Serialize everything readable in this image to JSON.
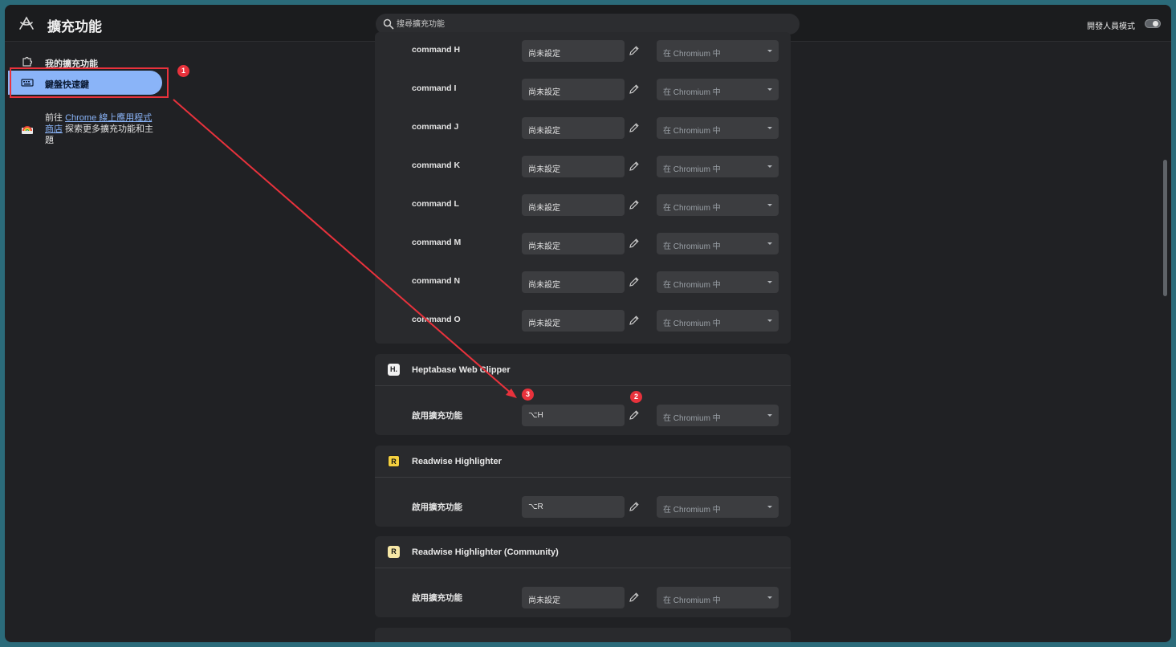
{
  "app": {
    "title": "擴充功能"
  },
  "search": {
    "placeholder": "搜尋擴充功能"
  },
  "dev_mode": {
    "label": "開發人員模式",
    "enabled": false
  },
  "sidebar": {
    "items": [
      {
        "label": "我的擴充功能",
        "icon": "puzzle-icon",
        "selected": false
      },
      {
        "label": "鍵盤快速鍵",
        "icon": "keyboard-icon",
        "selected": true
      }
    ],
    "store": {
      "prefix": "前往 ",
      "link_text": "Chrome 線上應用程式商店",
      "suffix": " 探索更多擴充功能和主題"
    }
  },
  "scope_text": "在 Chromium 中",
  "top_card": {
    "rows": [
      {
        "command": "command H",
        "shortcut": "尚未設定"
      },
      {
        "command": "command I",
        "shortcut": "尚未設定"
      },
      {
        "command": "command J",
        "shortcut": "尚未設定"
      },
      {
        "command": "command K",
        "shortcut": "尚未設定"
      },
      {
        "command": "command L",
        "shortcut": "尚未設定"
      },
      {
        "command": "command M",
        "shortcut": "尚未設定"
      },
      {
        "command": "command N",
        "shortcut": "尚未設定"
      },
      {
        "command": "command O",
        "shortcut": "尚未設定"
      }
    ]
  },
  "extensions": [
    {
      "name": "Heptabase Web Clipper",
      "icon": "heptabase-icon",
      "icon_text": "H.",
      "command": "啟用擴充功能",
      "shortcut": "⌥H"
    },
    {
      "name": "Readwise Highlighter",
      "icon": "readwise-icon",
      "icon_text": "R",
      "command": "啟用擴充功能",
      "shortcut": "⌥R"
    },
    {
      "name": "Readwise Highlighter (Community)",
      "icon": "readwise-community-icon",
      "icon_text": "R",
      "command": "啟用擴充功能",
      "shortcut": "尚未設定"
    }
  ],
  "annotations": {
    "badge1": "1",
    "badge2": "2",
    "badge3": "3"
  },
  "colors": {
    "accent": "#8ab4f8",
    "annotation": "#e8323c",
    "background": "#202124",
    "card": "#292a2d"
  }
}
